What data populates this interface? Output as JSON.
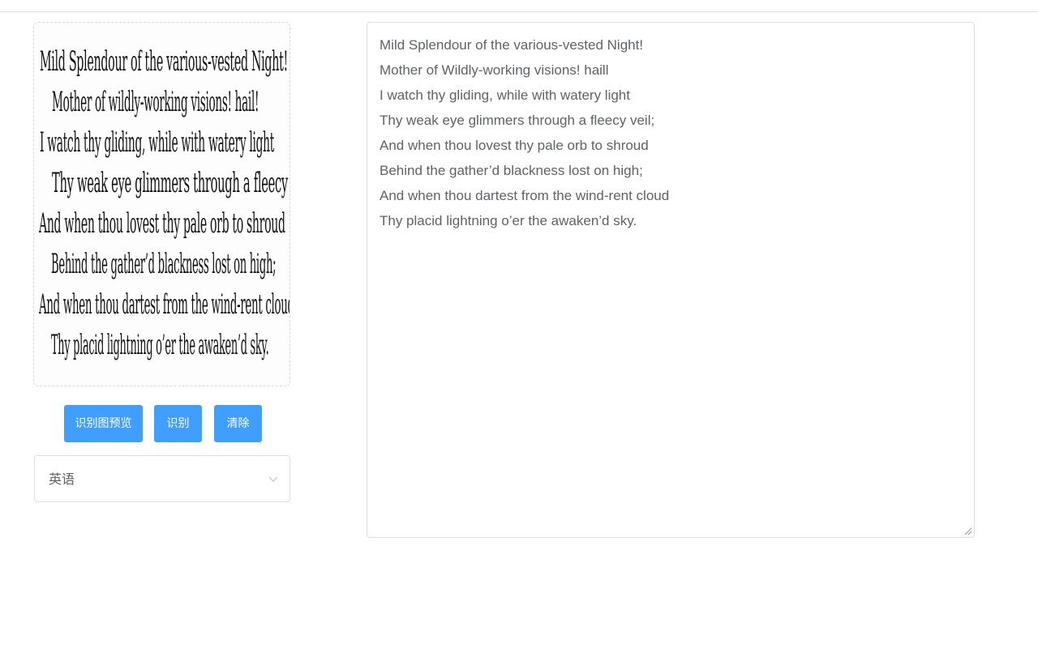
{
  "image_preview": {
    "lines": [
      "Mild Splendour of the various-vested Night!",
      "Mother of wildly-working visions! hail!",
      "I watch thy gliding, while with watery light",
      "Thy weak eye glimmers through a fleecy veil;",
      "And when thou lovest thy pale orb to shroud",
      "Behind the gather’d blackness lost on high;",
      "And when thou dartest from the wind-rent cloud",
      "Thy placid lightning o’er the awaken’d sky."
    ]
  },
  "buttons": {
    "preview_label": "识别图预览",
    "recognize_label": "识别",
    "clear_label": "清除"
  },
  "language_select": {
    "value": "英语",
    "icon": "chevron-down-icon"
  },
  "result_text": {
    "lines": [
      "Mild Splendour of the various-vested Night!",
      "Mother of Wildly-working visions! haill",
      "I watch thy gliding, while with watery light",
      "Thy weak eye glimmers through a fleecy veil;",
      "And when thou lovest thy pale orb to shroud",
      "Behind the gather’d blackness lost on high;",
      "And when thou dartest from the wind-rent cloud",
      "Thy placid lightning o’er the awaken’d sky."
    ]
  },
  "colors": {
    "accent": "#409eff",
    "border": "#dcdfe6",
    "text": "#606266"
  }
}
